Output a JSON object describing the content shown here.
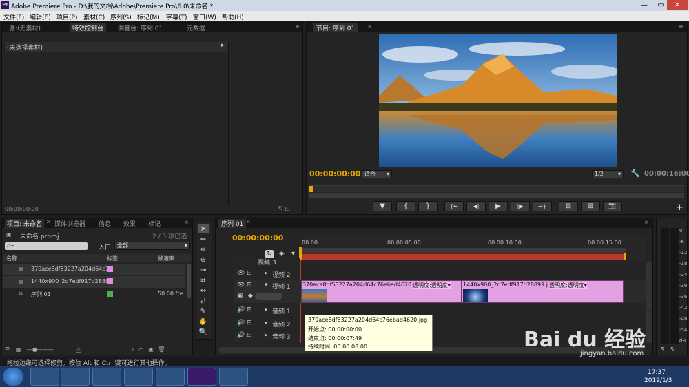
{
  "window": {
    "title": "Adobe Premiere Pro - D:\\我的文档\\Adobe\\Premiere Pro\\6.0\\未命名 *",
    "app_icon_text": "Pr",
    "minimize": "—",
    "maximize": "▭",
    "close": "✕"
  },
  "menu": [
    "文件(F)",
    "编辑(E)",
    "项目(P)",
    "素材(C)",
    "序列(S)",
    "标记(M)",
    "字幕(T)",
    "窗口(W)",
    "帮助(H)"
  ],
  "source_panel": {
    "tabs": [
      "源:(无素材)",
      "特效控制台",
      "调音台: 序列 01",
      "元数据"
    ],
    "empty_label": "(未选择素材)",
    "timecode": "00:00:00:00"
  },
  "program_panel": {
    "tab": "节目: 序列 01",
    "timecode": "00:00:00:00",
    "fit_label": "适合",
    "quality": "1/2",
    "duration": "00:00:16:00",
    "colors": {
      "sky": "#3f7fc4",
      "mountain": "#d88a2a",
      "water": "#2c6aa8"
    }
  },
  "transport": [
    "▼",
    "{",
    "}",
    "{←",
    "◀|",
    "▶",
    "|▶",
    "→}",
    "⊟",
    "⊞",
    "📷"
  ],
  "project_panel": {
    "tabs": [
      "项目: 未命名",
      "媒体浏览器",
      "信息",
      "效果",
      "标记"
    ],
    "project_file": "未命名.prproj",
    "selection_info": "2 / 3 项已选择",
    "search_placeholder": "ρ~",
    "in_label": "入口:",
    "in_value": "全部",
    "columns": [
      "名称",
      "标签",
      "帧速率"
    ],
    "items": [
      {
        "name": "370ace8df53227a204d64c7",
        "label_color": "#e38ae3",
        "rate": ""
      },
      {
        "name": "1440x900_2d7edf917d2889!",
        "label_color": "#e38ae3",
        "rate": ""
      },
      {
        "name": "序列 01",
        "label_color": "#4cae4c",
        "rate": "50.00 fps"
      }
    ]
  },
  "tools": [
    "➤",
    "⇔",
    "⇹",
    "⊕",
    "⇥",
    "⧉",
    "↔",
    "⇄",
    "✎",
    "✋",
    "🔍"
  ],
  "timeline": {
    "tab": "序列 01",
    "timecode": "00:00:00:00",
    "ruler": [
      "00:00",
      "00:00:05:00",
      "00:00:10:00",
      "00:00:15:00"
    ],
    "tracks": {
      "video": [
        "视频 3",
        "视频 2",
        "视频 1"
      ],
      "audio": [
        "音频 1",
        "音频 2",
        "音频 3"
      ]
    },
    "clip1": {
      "name": "370ace8df53227a204d64c76ebad4620.jpg",
      "opacity": "透明度:透明度▾"
    },
    "clip2": {
      "name": "1440x900_2d7edf917d28899.jpg",
      "opacity": "透明度:透明度▾"
    }
  },
  "tooltip": {
    "name": "370ace8df53227a204d64c76ebad4620.jpg",
    "start": "开始点: 00:00:00:00",
    "end": "结束点: 00:00:07:49",
    "duration": "持续时间: 00:00:08:00"
  },
  "audio_meter": {
    "levels": [
      "0",
      "-6",
      "-12",
      "-18",
      "-24",
      "-30",
      "-36",
      "-42",
      "-48",
      "-54",
      "dB"
    ],
    "solo": [
      "S",
      "S"
    ]
  },
  "status_bar": "拖拉边缘可选择修剪。按住 Alt 和 Ctrl 键可进行其他操作。",
  "watermark": {
    "text": "Bai du 经验",
    "url": "jingyan.baidu.com"
  },
  "taskbar": {
    "time": "17:37",
    "date": "2019/1/3"
  }
}
